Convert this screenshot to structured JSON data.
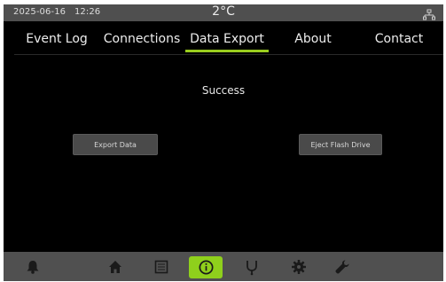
{
  "status": {
    "datetime": "2025-06-16   12:26",
    "temperature": "2°C",
    "network_icon": "network-icon"
  },
  "tabs": [
    {
      "label": "Event Log"
    },
    {
      "label": "Connections"
    },
    {
      "label": "Data Export",
      "active": true
    },
    {
      "label": "About"
    },
    {
      "label": "Contact"
    }
  ],
  "main": {
    "message": "Success",
    "export_button": "Export Data",
    "eject_button": "Eject Flash Drive"
  },
  "bottom_nav": {
    "items": [
      "bell-icon",
      "home-icon",
      "list-icon",
      "info-icon",
      "probe-icon",
      "gear-icon",
      "wrench-icon"
    ],
    "active": "info-icon"
  },
  "colors": {
    "accent": "#8fd01c",
    "bar_bg": "#505050",
    "screen_bg": "#000000",
    "button_bg": "#4a4a4a"
  }
}
